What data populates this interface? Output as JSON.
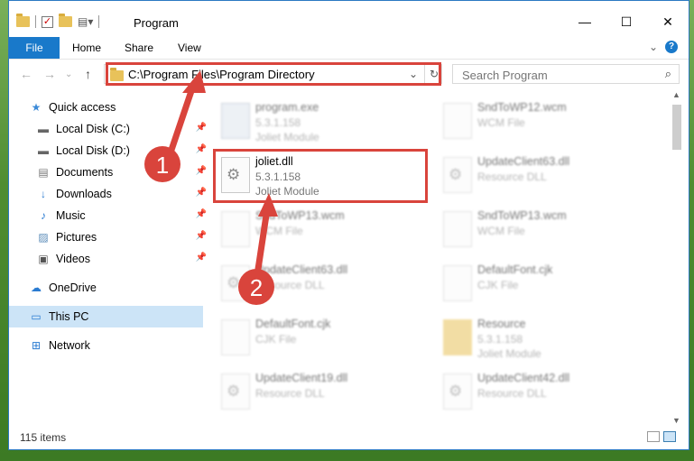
{
  "window": {
    "title": "Program"
  },
  "title_buttons": {
    "minimize": "—",
    "maximize": "☐",
    "close": "✕"
  },
  "ribbon": {
    "tabs": [
      "File",
      "Home",
      "Share",
      "View"
    ],
    "collapse": "⌄",
    "help": "?"
  },
  "nav": {
    "back": "←",
    "forward": "→",
    "dropdown": "⌄",
    "up": "↑"
  },
  "address": {
    "path": "C:\\Program Files\\Program Directory",
    "dropdown": "⌄",
    "refresh": "↻"
  },
  "search": {
    "placeholder": "Search Program",
    "icon": "search-icon"
  },
  "sidebar": {
    "items": [
      {
        "label": "Quick access",
        "icon": "star-icon",
        "glyph": "★"
      },
      {
        "label": "Local Disk (C:)",
        "icon": "drive-icon",
        "glyph": "▬"
      },
      {
        "label": "Local Disk (D:)",
        "icon": "drive-icon",
        "glyph": "▬"
      },
      {
        "label": "Documents",
        "icon": "documents-icon",
        "glyph": "▤"
      },
      {
        "label": "Downloads",
        "icon": "download-icon",
        "glyph": "↓"
      },
      {
        "label": "Music",
        "icon": "music-icon",
        "glyph": "♪"
      },
      {
        "label": "Pictures",
        "icon": "pictures-icon",
        "glyph": "▨"
      },
      {
        "label": "Videos",
        "icon": "videos-icon",
        "glyph": "▣"
      },
      {
        "label": "OneDrive",
        "icon": "cloud-icon",
        "glyph": "☁"
      },
      {
        "label": "This PC",
        "icon": "computer-icon",
        "glyph": "▭"
      },
      {
        "label": "Network",
        "icon": "network-icon",
        "glyph": "⊞"
      }
    ],
    "pin": "📌"
  },
  "files": [
    {
      "name": "program.exe",
      "line2": "5.3.1.158",
      "line3": "Joliet Module",
      "icon": "exe"
    },
    {
      "name": "SndToWP12.wcm",
      "line2": "WCM File",
      "line3": "",
      "icon": "doc"
    },
    {
      "name": "joliet.dll",
      "line2": "5.3.1.158",
      "line3": "Joliet Module",
      "icon": "gear"
    },
    {
      "name": "UpdateClient63.dll",
      "line2": "Resource DLL",
      "line3": "",
      "icon": "gear"
    },
    {
      "name": "SndToWP13.wcm",
      "line2": "WCM File",
      "line3": "",
      "icon": "doc"
    },
    {
      "name": "SndToWP13.wcm",
      "line2": "WCM File",
      "line3": "",
      "icon": "doc"
    },
    {
      "name": "UpdateClient63.dll",
      "line2": "Resource DLL",
      "line3": "",
      "icon": "gear"
    },
    {
      "name": "DefaultFont.cjk",
      "line2": "CJK File",
      "line3": "",
      "icon": "doc"
    },
    {
      "name": "DefaultFont.cjk",
      "line2": "CJK File",
      "line3": "",
      "icon": "doc"
    },
    {
      "name": "Resource",
      "line2": "5.3.1.158",
      "line3": "Joliet Module",
      "icon": "folder"
    },
    {
      "name": "UpdateClient19.dll",
      "line2": "Resource DLL",
      "line3": "",
      "icon": "gear"
    },
    {
      "name": "UpdateClient42.dll",
      "line2": "Resource DLL",
      "line3": "",
      "icon": "gear"
    }
  ],
  "status": {
    "items": "115 items"
  },
  "annotations": {
    "step1": "1",
    "step2": "2",
    "color": "#d9443c"
  }
}
